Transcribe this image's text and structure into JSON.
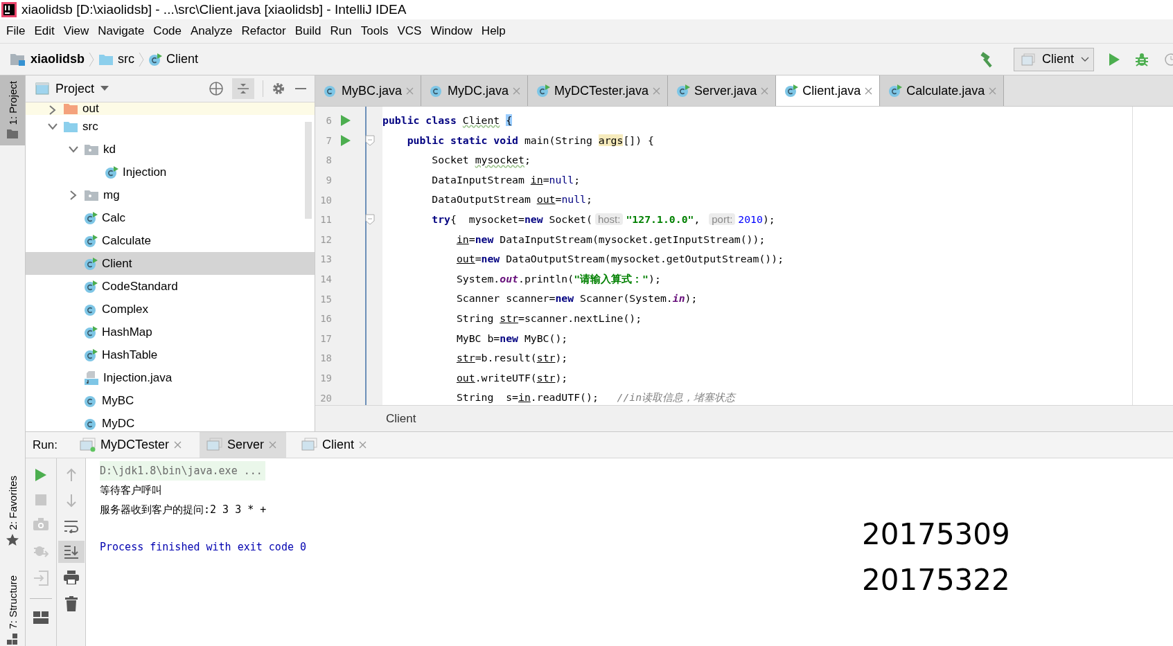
{
  "window": {
    "title": "xiaolidsb [D:\\xiaolidsb] - ...\\src\\Client.java [xiaolidsb] - IntelliJ IDEA"
  },
  "menu": [
    "File",
    "Edit",
    "View",
    "Navigate",
    "Code",
    "Analyze",
    "Refactor",
    "Build",
    "Run",
    "Tools",
    "VCS",
    "Window",
    "Help"
  ],
  "navigation": {
    "breadcrumbs": [
      {
        "label": "xiaolidsb",
        "kind": "project"
      },
      {
        "label": "src",
        "kind": "folder"
      },
      {
        "label": "Client",
        "kind": "runnable_class"
      }
    ],
    "run_config": "Client"
  },
  "tool_stripe": [
    {
      "label": "1: Project",
      "kind": "project",
      "selected": true
    },
    {
      "label": "2: Favorites",
      "kind": "favorites",
      "selected": false
    },
    {
      "label": "7: Structure",
      "kind": "structure",
      "selected": false
    }
  ],
  "project_panel": {
    "title": "Project",
    "tree": [
      {
        "label": "out",
        "kind": "excluded_folder",
        "expanded": false,
        "selected": false
      },
      {
        "label": "src",
        "kind": "folder",
        "expanded": true,
        "selected": false,
        "children": [
          {
            "label": "kd",
            "kind": "package",
            "expanded": true,
            "selected": false,
            "children": [
              {
                "label": "Injection",
                "kind": "runnable_class",
                "selected": false
              }
            ]
          },
          {
            "label": "mg",
            "kind": "package",
            "expanded": false,
            "selected": false
          },
          {
            "label": "Calc",
            "kind": "runnable_class",
            "selected": false
          },
          {
            "label": "Calculate",
            "kind": "runnable_class",
            "selected": false
          },
          {
            "label": "Client",
            "kind": "runnable_class",
            "selected": true
          },
          {
            "label": "CodeStandard",
            "kind": "runnable_class",
            "selected": false
          },
          {
            "label": "Complex",
            "kind": "class",
            "selected": false
          },
          {
            "label": "HashMap",
            "kind": "runnable_class",
            "selected": false
          },
          {
            "label": "HashTable",
            "kind": "runnable_class",
            "selected": false
          },
          {
            "label": "Injection.java",
            "kind": "java_file",
            "selected": false
          },
          {
            "label": "MyBC",
            "kind": "class",
            "selected": false
          },
          {
            "label": "MyDC",
            "kind": "class",
            "selected": false
          }
        ]
      }
    ]
  },
  "editor": {
    "tabs": [
      {
        "label": "MyBC.java",
        "kind": "class",
        "selected": false
      },
      {
        "label": "MyDC.java",
        "kind": "class",
        "selected": false
      },
      {
        "label": "MyDCTester.java",
        "kind": "runnable_class",
        "selected": false
      },
      {
        "label": "Server.java",
        "kind": "runnable_class",
        "selected": false
      },
      {
        "label": "Client.java",
        "kind": "runnable_class",
        "selected": true
      },
      {
        "label": "Calculate.java",
        "kind": "runnable_class",
        "selected": false
      }
    ],
    "lines": [
      {
        "number": "6",
        "run_marker": true,
        "fold_marker": false,
        "tokens": [
          {
            "text": "public class ",
            "kind": "keyword"
          },
          {
            "text": "Client",
            "kind": "warning"
          },
          {
            "text": "{",
            "kind": "brace_match"
          }
        ],
        "children": [
          {
            "number": "7",
            "run_marker": true,
            "fold_marker": true,
            "tokens": [
              {
                "text": "public static void ",
                "kind": "keyword"
              },
              {
                "text": "main(String ",
                "kind": "plain"
              },
              {
                "text": "args",
                "kind": "highlight"
              },
              {
                "text": "[]) {",
                "kind": "plain"
              }
            ],
            "children": [
              {
                "number": "8",
                "run_marker": false,
                "fold_marker": false,
                "tokens": [
                  {
                    "text": "Socket ",
                    "kind": "plain"
                  },
                  {
                    "text": "mysocket",
                    "kind": "warning"
                  },
                  {
                    "text": ";",
                    "kind": "plain"
                  }
                ]
              },
              {
                "number": "9",
                "run_marker": false,
                "fold_marker": false,
                "tokens": [
                  {
                    "text": "DataInputStream ",
                    "kind": "plain"
                  },
                  {
                    "text": "in",
                    "kind": "reassigned"
                  },
                  {
                    "text": "=",
                    "kind": "plain"
                  },
                  {
                    "text": "null",
                    "kind": "literal"
                  },
                  {
                    "text": ";",
                    "kind": "plain"
                  }
                ]
              },
              {
                "number": "10",
                "run_marker": false,
                "fold_marker": false,
                "tokens": [
                  {
                    "text": "DataOutputStream ",
                    "kind": "plain"
                  },
                  {
                    "text": "out",
                    "kind": "reassigned"
                  },
                  {
                    "text": "=",
                    "kind": "plain"
                  },
                  {
                    "text": "null",
                    "kind": "literal"
                  },
                  {
                    "text": ";",
                    "kind": "plain"
                  }
                ]
              },
              {
                "number": "11",
                "run_marker": false,
                "fold_marker": true,
                "tokens": [
                  {
                    "text": "try",
                    "kind": "keyword"
                  },
                  {
                    "text": "{  mysocket=",
                    "kind": "plain"
                  },
                  {
                    "text": "new",
                    "kind": "keyword"
                  },
                  {
                    "text": " Socket(",
                    "kind": "plain"
                  },
                  {
                    "text": "host:",
                    "kind": "hint"
                  },
                  {
                    "text": "\"127.1.0.0\"",
                    "kind": "string"
                  },
                  {
                    "text": ", ",
                    "kind": "plain"
                  },
                  {
                    "text": "port:",
                    "kind": "hint"
                  },
                  {
                    "text": "2010",
                    "kind": "number"
                  },
                  {
                    "text": ");",
                    "kind": "plain"
                  }
                ],
                "children": [
                  {
                    "number": "12",
                    "run_marker": false,
                    "fold_marker": false,
                    "tokens": [
                      {
                        "text": "in",
                        "kind": "reassigned"
                      },
                      {
                        "text": "=",
                        "kind": "plain"
                      },
                      {
                        "text": "new",
                        "kind": "keyword"
                      },
                      {
                        "text": " DataInputStream(mysocket.getInputStream());",
                        "kind": "plain"
                      }
                    ]
                  },
                  {
                    "number": "13",
                    "run_marker": false,
                    "fold_marker": false,
                    "tokens": [
                      {
                        "text": "out",
                        "kind": "reassigned"
                      },
                      {
                        "text": "=",
                        "kind": "plain"
                      },
                      {
                        "text": "new",
                        "kind": "keyword"
                      },
                      {
                        "text": " DataOutputStream(mysocket.getOutputStream());",
                        "kind": "plain"
                      }
                    ]
                  },
                  {
                    "number": "14",
                    "run_marker": false,
                    "fold_marker": false,
                    "tokens": [
                      {
                        "text": "System.",
                        "kind": "plain"
                      },
                      {
                        "text": "out",
                        "kind": "static_field"
                      },
                      {
                        "text": ".println(",
                        "kind": "plain"
                      },
                      {
                        "text": "\"请输入算式：\"",
                        "kind": "string"
                      },
                      {
                        "text": ");",
                        "kind": "plain"
                      }
                    ]
                  },
                  {
                    "number": "15",
                    "run_marker": false,
                    "fold_marker": false,
                    "tokens": [
                      {
                        "text": "Scanner scanner=",
                        "kind": "plain"
                      },
                      {
                        "text": "new",
                        "kind": "keyword"
                      },
                      {
                        "text": " Scanner(System.",
                        "kind": "plain"
                      },
                      {
                        "text": "in",
                        "kind": "static_field"
                      },
                      {
                        "text": ");",
                        "kind": "plain"
                      }
                    ]
                  },
                  {
                    "number": "16",
                    "run_marker": false,
                    "fold_marker": false,
                    "tokens": [
                      {
                        "text": "String ",
                        "kind": "plain"
                      },
                      {
                        "text": "str",
                        "kind": "reassigned"
                      },
                      {
                        "text": "=scanner.nextLine();",
                        "kind": "plain"
                      }
                    ]
                  },
                  {
                    "number": "17",
                    "run_marker": false,
                    "fold_marker": false,
                    "tokens": [
                      {
                        "text": "MyBC b=",
                        "kind": "plain"
                      },
                      {
                        "text": "new",
                        "kind": "keyword"
                      },
                      {
                        "text": " MyBC();",
                        "kind": "plain"
                      }
                    ]
                  },
                  {
                    "number": "18",
                    "run_marker": false,
                    "fold_marker": false,
                    "tokens": [
                      {
                        "text": "str",
                        "kind": "reassigned"
                      },
                      {
                        "text": "=b.result(",
                        "kind": "plain"
                      },
                      {
                        "text": "str",
                        "kind": "reassigned"
                      },
                      {
                        "text": ");",
                        "kind": "plain"
                      }
                    ]
                  },
                  {
                    "number": "19",
                    "run_marker": false,
                    "fold_marker": false,
                    "tokens": [
                      {
                        "text": "out",
                        "kind": "reassigned"
                      },
                      {
                        "text": ".writeUTF(",
                        "kind": "plain"
                      },
                      {
                        "text": "str",
                        "kind": "reassigned"
                      },
                      {
                        "text": ");",
                        "kind": "plain"
                      }
                    ]
                  },
                  {
                    "number": "20",
                    "run_marker": false,
                    "fold_marker": false,
                    "tokens": [
                      {
                        "text": "String  s=",
                        "kind": "plain"
                      },
                      {
                        "text": "in",
                        "kind": "reassigned"
                      },
                      {
                        "text": ".readUTF();   ",
                        "kind": "plain"
                      },
                      {
                        "text": "//in读取信息，堵塞状态",
                        "kind": "comment"
                      }
                    ]
                  }
                ]
              }
            ]
          }
        ]
      }
    ],
    "breadcrumb": "Client"
  },
  "run_panel": {
    "label": "Run:",
    "tabs": [
      {
        "label": "MyDCTester",
        "running": true,
        "selected": false
      },
      {
        "label": "Server",
        "running": false,
        "selected": true
      },
      {
        "label": "Client",
        "running": false,
        "selected": false
      }
    ],
    "console": [
      {
        "text": "D:\\jdk1.8\\bin\\java.exe ...",
        "kind": "command"
      },
      {
        "text": "等待客户呼叫",
        "kind": "output"
      },
      {
        "text": "服务器收到客户的提问:2 3 3 * +",
        "kind": "output"
      },
      {
        "text": "Process finished with exit code 0",
        "kind": "system"
      }
    ]
  },
  "overlay_notes": [
    "20175309",
    "20175322"
  ]
}
